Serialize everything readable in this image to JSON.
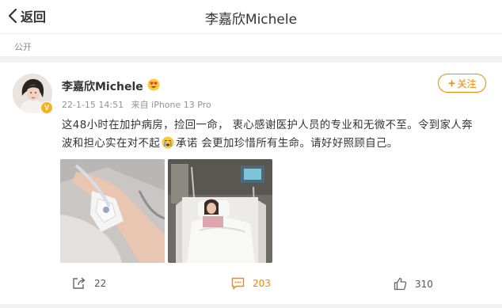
{
  "header": {
    "back_label": "返回",
    "title": "李嘉欣Michele"
  },
  "post": {
    "visibility": "公开",
    "author": "李嘉欣Michele",
    "date": "22-1-15 14:51",
    "source": "来自 iPhone 13 Pro",
    "follow_label": "关注",
    "text_part1": "这48小时在加护病房，捡回一命， 衷心感谢医护人员的专业和无微不至。令到家人奔波和担心实在对不起",
    "text_part2": "承诺 会更加珍惜所有生命。请好好照顾自己。",
    "verified_badge": "V"
  },
  "actions": {
    "share_count": "22",
    "comment_count": "203",
    "like_count": "310"
  },
  "colors": {
    "accent": "#ff8200",
    "badge": "#f7b11f",
    "meta_text": "#939393"
  },
  "icons": [
    "back-chevron-icon",
    "heart-eyes-emoji-icon",
    "crying-emoji-icon",
    "share-icon",
    "comment-icon",
    "thumbs-up-icon"
  ]
}
